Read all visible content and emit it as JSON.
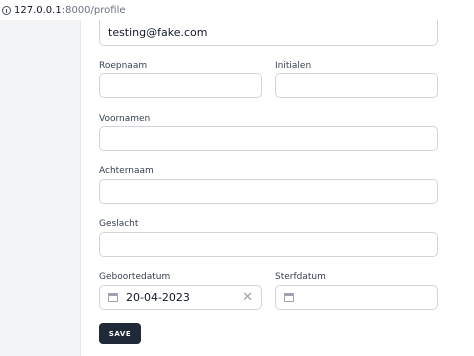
{
  "browser": {
    "url_host": "127.0.0.1",
    "url_rest": ":8000/profile"
  },
  "form": {
    "email_value": "testing@fake.com",
    "roepnaam_label": "Roepnaam",
    "initialen_label": "Initialen",
    "voornamen_label": "Voornamen",
    "achternaam_label": "Achternaam",
    "geslacht_label": "Geslacht",
    "geboortedatum_label": "Geboortedatum",
    "geboortedatum_value": "20-04-2023",
    "sterfdatum_label": "Sterfdatum",
    "save_label": "SAVE"
  }
}
